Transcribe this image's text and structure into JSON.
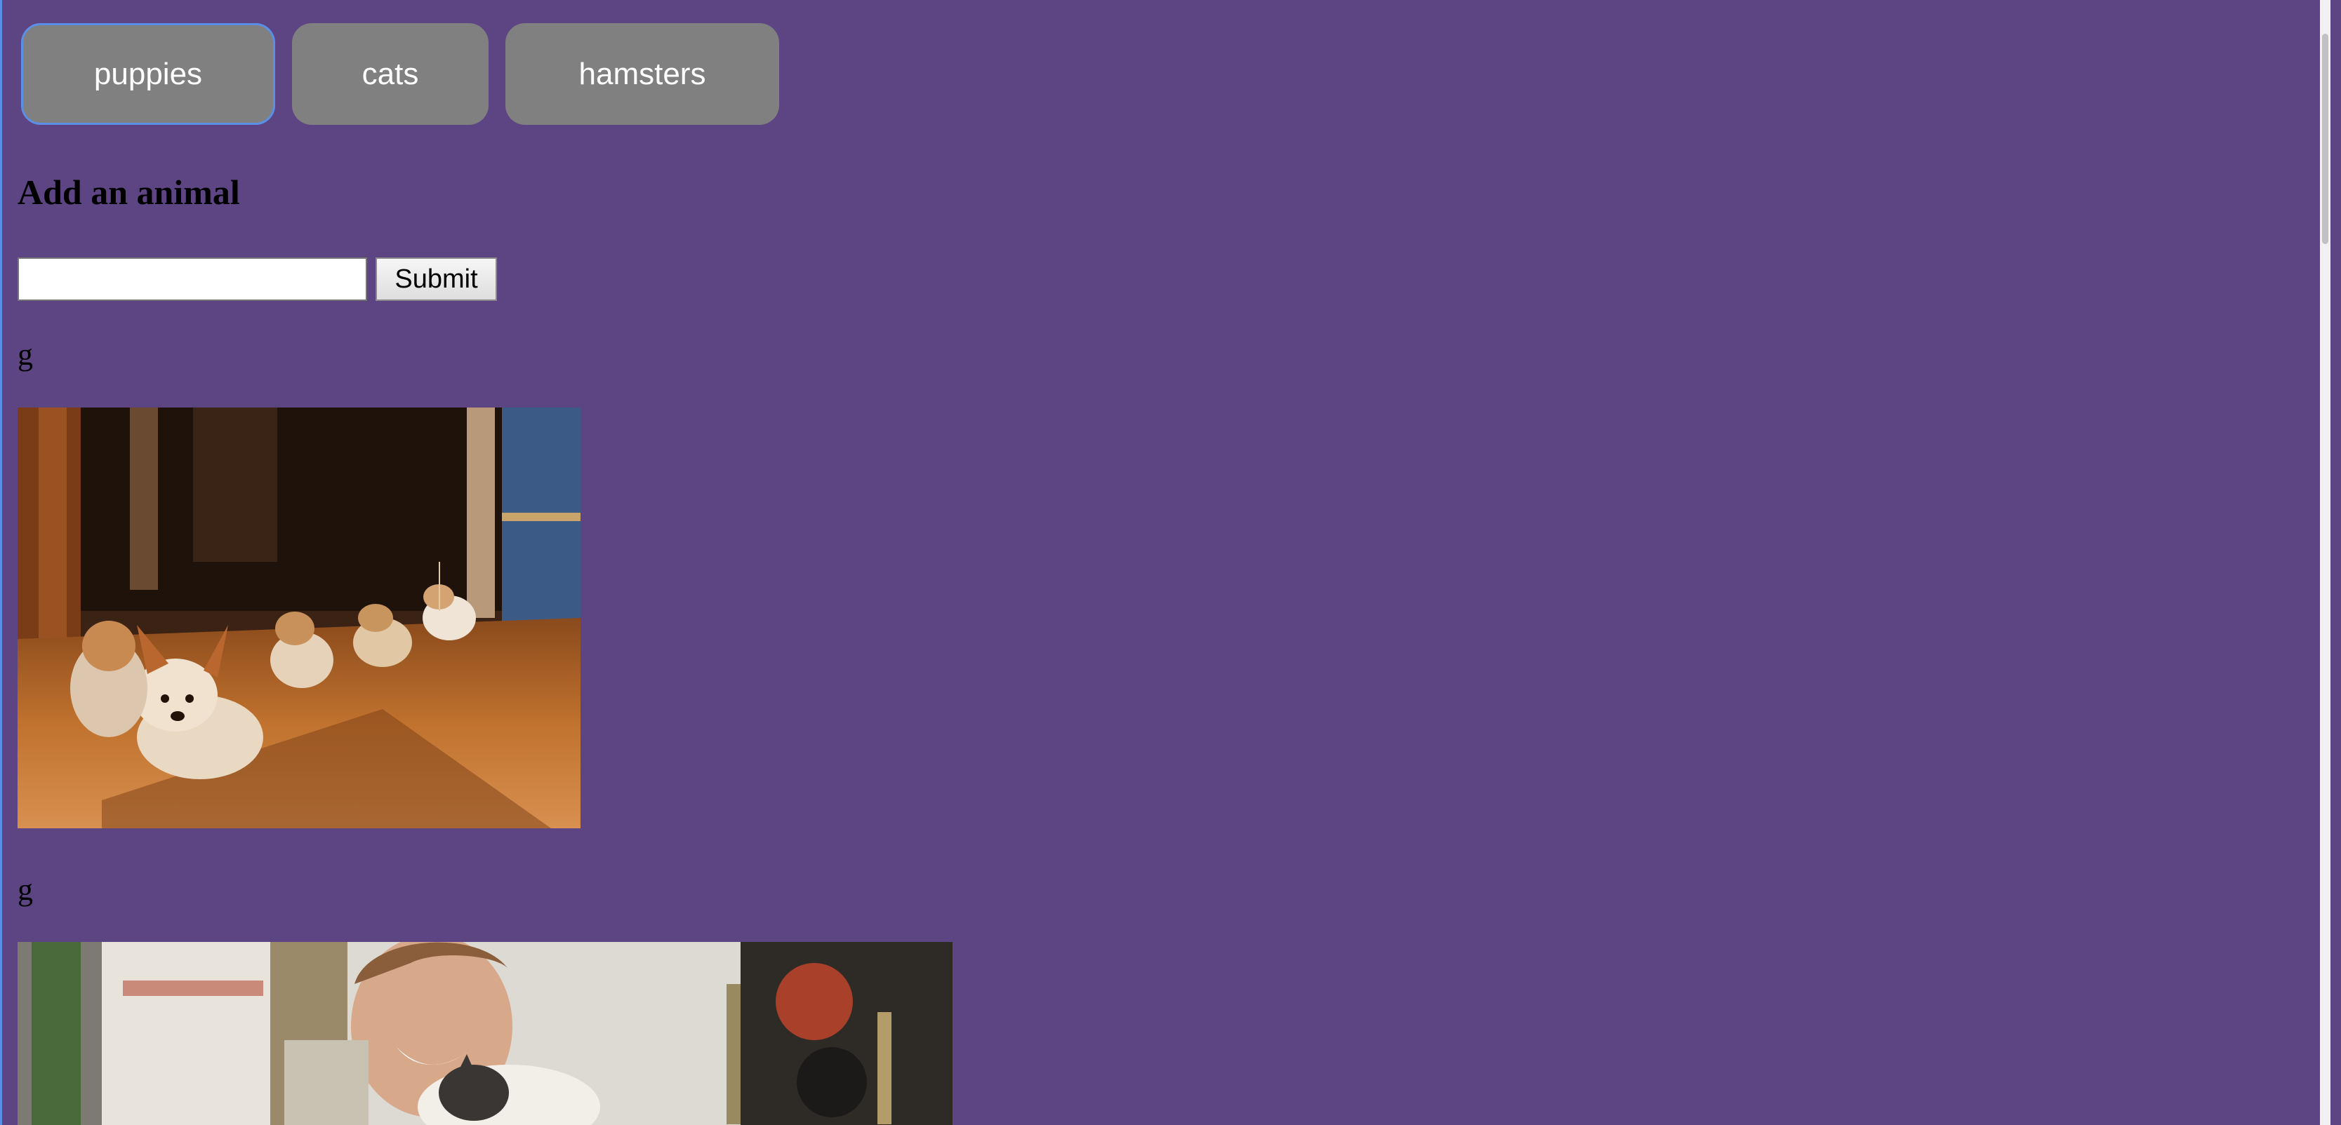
{
  "tabs": [
    {
      "label": "puppies"
    },
    {
      "label": "cats"
    },
    {
      "label": "hamsters"
    }
  ],
  "form": {
    "title": "Add an animal",
    "input_value": "",
    "input_placeholder": "",
    "submit_label": "Submit"
  },
  "entries": [
    {
      "name": "g"
    },
    {
      "name": "g"
    }
  ],
  "colors": {
    "background": "#5d4584",
    "button_bg": "#808080",
    "button_text": "#ffffff",
    "focus_outline": "#5b8ee6"
  }
}
